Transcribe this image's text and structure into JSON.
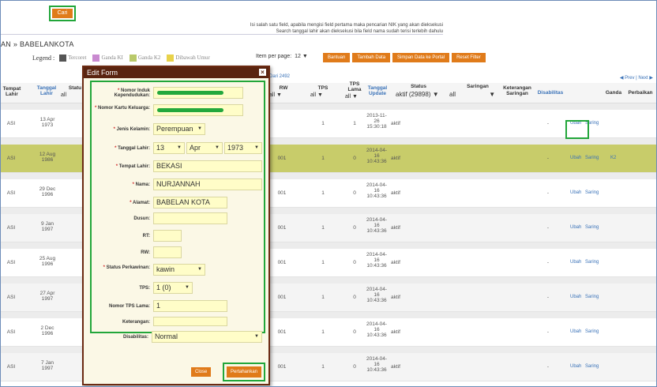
{
  "top": {
    "cari_label": "Cari",
    "hint_line1": "Isi salah satu field, apabila mengisi field pertama maka pencarian NIK yang akan dieksekusi",
    "hint_line2": "Search tanggal lahir akan dieksekusi bila field nama sudah terisi terlebih dahulu",
    "breadcrumb": "AN » BABELANKOTA"
  },
  "legend": {
    "label": "Legend :",
    "items": [
      {
        "label": "Tercoret",
        "color": "#555555"
      },
      {
        "label": "Ganda KI",
        "color": "#c98ad0"
      },
      {
        "label": "Ganda K2",
        "color": "#b9c96a"
      },
      {
        "label": "Dibawah Umur",
        "color": "#e8d24a"
      }
    ],
    "perpage_label": "Item per page:",
    "perpage_value": "12"
  },
  "toolbar": {
    "buttons": [
      "Bantuan",
      "Tambah Data",
      "Simpan Data ke Portal",
      "Reset Filter"
    ]
  },
  "table": {
    "pager": "◀ Prev | Next ▶",
    "count_note": "Dari 2492",
    "headers": {
      "tempat_lahir": "Tempat Lahir",
      "tanggal_lahir": "Tanggal Lahir",
      "status_col": "Statu",
      "rw": "RW",
      "tps": "TPS",
      "tps_lama": "TPS Lama",
      "tanggal_update": "Tanggal Update",
      "status": "Status",
      "saringan": "Saringan",
      "keterangan_saringan": "Keterangan Saringan",
      "disabilitas": "Disabilitas",
      "ganda": "Ganda",
      "perbaikan": "Perbaikan"
    },
    "filters": {
      "all": "all",
      "status_value": "aktif (29898)"
    },
    "rows": [
      {
        "tempat": "ASI",
        "tgl": "13 Apr 1973",
        "rw": "",
        "tps": "1",
        "tps_lama": "1",
        "update": "2013-11-26 15:30:18",
        "status": "aktif",
        "ket": "-",
        "ubah": "Ubah",
        "saring": "Saring",
        "ganda": ""
      },
      {
        "tempat": "ASI",
        "tgl": "12 Aug 1986",
        "rw": "001",
        "tps": "1",
        "tps_lama": "0",
        "update": "2014-04-16 10:43:36",
        "status": "aktif",
        "ket": "-",
        "ubah": "Ubah",
        "saring": "Saring",
        "ganda": "K2"
      },
      {
        "tempat": "ASI",
        "tgl": "29 Dec 1996",
        "rw": "001",
        "tps": "1",
        "tps_lama": "0",
        "update": "2014-04-16 10:43:36",
        "status": "aktif",
        "ket": "-",
        "ubah": "Ubah",
        "saring": "Saring",
        "ganda": ""
      },
      {
        "tempat": "ASI",
        "tgl": "9 Jan 1997",
        "rw": "001",
        "tps": "1",
        "tps_lama": "0",
        "update": "2014-04-16 10:43:36",
        "status": "aktif",
        "ket": "-",
        "ubah": "Ubah",
        "saring": "Saring",
        "ganda": ""
      },
      {
        "tempat": "ASI",
        "tgl": "25 Aug 1996",
        "rw": "001",
        "tps": "1",
        "tps_lama": "0",
        "update": "2014-04-16 10:43:36",
        "status": "aktif",
        "ket": "-",
        "ubah": "Ubah",
        "saring": "Saring",
        "ganda": ""
      },
      {
        "tempat": "ASI",
        "tgl": "27 Apr 1997",
        "rw": "001",
        "tps": "1",
        "tps_lama": "0",
        "update": "2014-04-16 10:43:36",
        "status": "aktif",
        "ket": "-",
        "ubah": "Ubah",
        "saring": "Saring",
        "ganda": ""
      },
      {
        "tempat": "ASI",
        "tgl": "2 Dec 1996",
        "rw": "001",
        "tps": "1",
        "tps_lama": "0",
        "update": "2014-04-16 10:43:36",
        "status": "aktif",
        "ket": "-",
        "ubah": "Ubah",
        "saring": "Saring",
        "ganda": ""
      },
      {
        "tempat": "ASI",
        "tgl": "7 Jan 1997",
        "rw": "001",
        "tps": "1",
        "tps_lama": "0",
        "update": "2014-04-16 10:43:36",
        "status": "aktif",
        "ket": "-",
        "ubah": "Ubah",
        "saring": "Saring",
        "ganda": ""
      }
    ]
  },
  "modal": {
    "title": "Edit Form",
    "close_icon": "×",
    "fields": {
      "nik_label": "Nomor Induk Kependudukan:",
      "kk_label": "Nomor Kartu Keluarga:",
      "jk_label": "Jenis Kelamin:",
      "jk_value": "Perempuan",
      "tgl_label": "Tanggal Lahir:",
      "tgl_day": "13",
      "tgl_month": "Apr",
      "tgl_year": "1973",
      "tempat_label": "Tempat Lahir:",
      "tempat_value": "BEKASI",
      "nama_label": "Nama:",
      "nama_value": "NURJANNAH",
      "alamat_label": "Alamat:",
      "alamat_value": "BABELAN KOTA",
      "dusun_label": "Dusun:",
      "rt_label": "RT:",
      "rw_label": "RW:",
      "status_label": "Status Perkawinan:",
      "status_value": "kawin",
      "tps_label": "TPS:",
      "tps_value": "1 (0)",
      "tpslama_label": "Nomor TPS Lama:",
      "tpslama_value": "1",
      "ket_label": "Keterangan:",
      "dis_label": "Disabilitas:",
      "dis_value": "Normal"
    },
    "close_label": "Close",
    "save_label": "Pertahankan"
  },
  "colors": {
    "accent_orange": "#e07b1a",
    "modal_brown": "#5a2410",
    "highlight_green": "#22a63a",
    "row_highlight": "#c8cc6a",
    "input_yellow": "#fffdc8"
  }
}
